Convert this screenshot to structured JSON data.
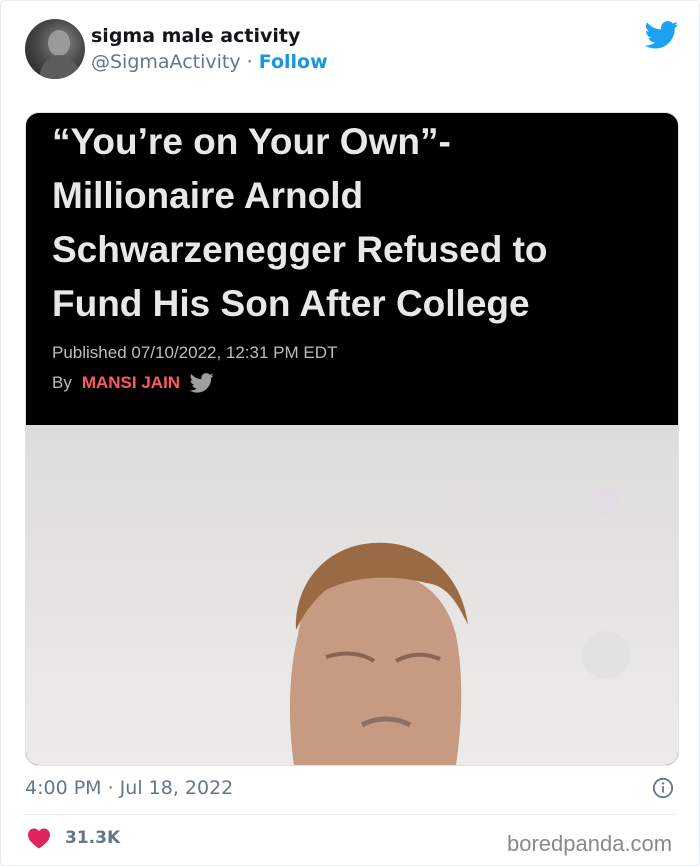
{
  "tweet": {
    "author_name": "sigma male activity",
    "author_handle": "@SigmaActivity",
    "separator": "·",
    "follow_label": "Follow",
    "timestamp": "4:00 PM · Jul 18, 2022",
    "like_count": "31.3K"
  },
  "article": {
    "headline_lines": [
      "“You’re on Your Own”-",
      "Millionaire Arnold",
      "Schwarzenegger Refused to",
      "Fund His Son After College"
    ],
    "published": "Published 07/10/2022, 12:31 PM EDT",
    "by_label": "By",
    "author": "MANSI JAIN"
  },
  "watermark": "boredpanda.com",
  "icons": {
    "brand": "twitter-bird-icon",
    "info": "info-icon",
    "like": "heart-icon"
  },
  "colors": {
    "twitter_blue": "#1da1f2",
    "follow_blue": "#1b95e0",
    "like_red": "#e0245e",
    "author_red": "#ff5a5f"
  }
}
